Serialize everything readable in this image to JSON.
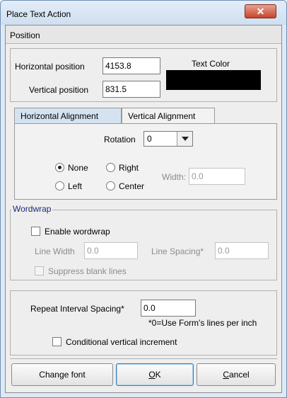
{
  "window": {
    "title": "Place Text Action",
    "close_glyph": "✕"
  },
  "position_section": {
    "header": "Position",
    "horizontal_label": "Horizontal position",
    "horizontal_value": "4153.8",
    "vertical_label": "Vertical position",
    "vertical_value": "831.5",
    "text_color_label": "Text Color",
    "text_color": "#000000"
  },
  "alignment_tabs": {
    "tabs": [
      "Horizontal Alignment",
      "Vertical Alignment"
    ],
    "active_tab": "Horizontal Alignment",
    "rotation_label": "Rotation",
    "rotation_value": "0",
    "radios": {
      "none": "None",
      "right": "Right",
      "left": "Left",
      "center": "Center",
      "selected": "None"
    },
    "width_label": "Width:",
    "width_value": "0.0"
  },
  "wordwrap": {
    "legend": "Wordwrap",
    "enable_label": "Enable wordwrap",
    "enable_checked": false,
    "line_width_label": "Line Width",
    "line_width_value": "0.0",
    "line_spacing_label": "Line Spacing*",
    "line_spacing_value": "0.0",
    "suppress_label": "Suppress blank lines",
    "suppress_checked": false
  },
  "repeat": {
    "label": "Repeat Interval Spacing*",
    "value": "0.0",
    "note": "*0=Use Form's lines per inch",
    "conditional_label": "Conditional vertical increment",
    "conditional_checked": false
  },
  "buttons": {
    "change_font": "Change font",
    "ok_mnemonic": "O",
    "ok_rest": "K",
    "cancel_mnemonic": "C",
    "cancel_rest": "ancel"
  },
  "colors": {
    "title_bg": "#dfe9f5",
    "close_btn": "#c7442c",
    "legend_text": "#1a2b7a",
    "active_tab": "#d5e3f1"
  }
}
